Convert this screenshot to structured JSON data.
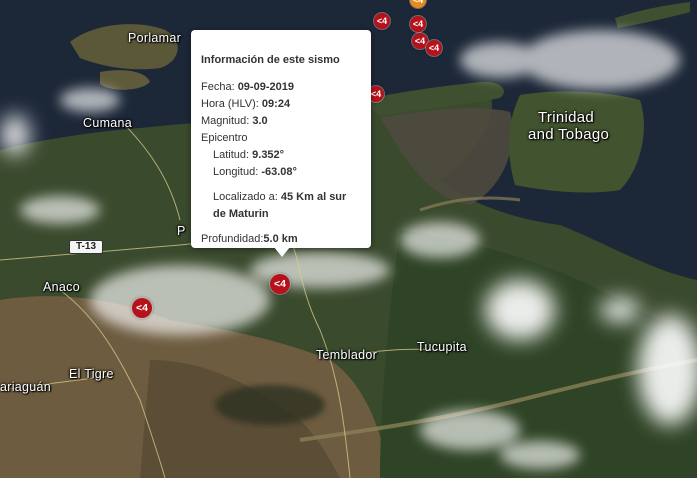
{
  "popup": {
    "title": "Información de este sismo",
    "fecha_label": "Fecha: ",
    "fecha": "09-09-2019",
    "hora_label": "Hora (HLV): ",
    "hora": "09:24",
    "magnitud_label": "Magnitud: ",
    "magnitud": "3.0",
    "epicentro_label": "Epicentro",
    "latitud_label": "Latitud: ",
    "latitud": "9.352°",
    "longitud_label": "Longitud: ",
    "longitud": "-63.08°",
    "localizado_label": "Localizado a: ",
    "localizado": "45 Km al sur de Maturin",
    "profundidad_label": "Profundidad:",
    "profundidad": "5.0 km"
  },
  "places": {
    "porlamar": "Porlamar",
    "cumana": "Cumana",
    "trinidad_line1": "Trinidad",
    "trinidad_line2": "and Tobago",
    "anaco": "Anaco",
    "el_tigre": "El Tigre",
    "temblador": "Temblador",
    "tucupita": "Tucupita",
    "mariaguan": "ariaguán",
    "partial_p": "P"
  },
  "road_shield": "T-13",
  "markers": [
    {
      "label": "<4",
      "color": "#b5121b"
    },
    {
      "label": "<4",
      "color": "#b5121b"
    },
    {
      "label": "<4",
      "color": "#b5121b"
    },
    {
      "label": "<4",
      "color": "#b5121b"
    },
    {
      "label": "<4",
      "color": "#b5121b"
    },
    {
      "label": "<4",
      "color": "#b5121b"
    },
    {
      "label": "<4",
      "color": "#b5121b"
    },
    {
      "label": "<4",
      "color": "#b5121b"
    },
    {
      "label": "<4",
      "color": "#e88a1a"
    }
  ],
  "colors": {
    "sea": "#1c2738",
    "land": "#3c4a2c",
    "savanna": "#6e5c40",
    "marker": "#b5121b",
    "marker_recent": "#e88a1a"
  }
}
